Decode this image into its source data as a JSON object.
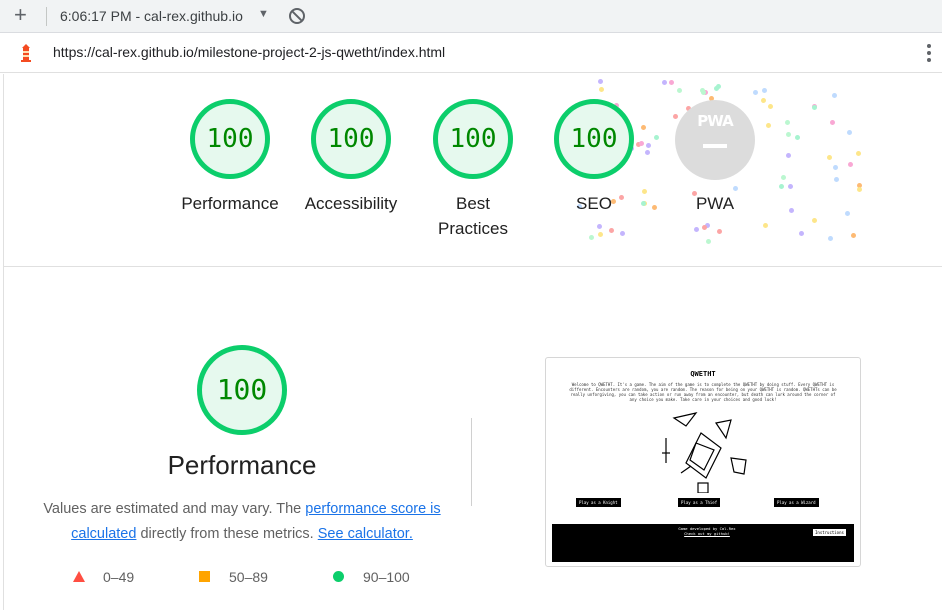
{
  "browser": {
    "tab_title": "6:06:17 PM - cal-rex.github.io",
    "url": "https://cal-rex.github.io/milestone-project-2-js-qwetht/index.html"
  },
  "summary_gauges": [
    {
      "label": "Performance",
      "score": "100"
    },
    {
      "label": "Accessibility",
      "score": "100"
    },
    {
      "label": "Best Practices",
      "score": "100"
    },
    {
      "label": "SEO",
      "score": "100"
    }
  ],
  "pwa": {
    "badge_text": "PWA",
    "label": "PWA"
  },
  "performance": {
    "score": "100",
    "title": "Performance",
    "desc_prefix": "Values are estimated and may vary. The ",
    "desc_link1": "performance score is calculated",
    "desc_mid": " directly from these metrics. ",
    "desc_link2": "See calculator."
  },
  "legend": [
    {
      "range": "0–49",
      "color": "#ff4e42"
    },
    {
      "range": "50–89",
      "color": "#ffa400"
    },
    {
      "range": "90–100",
      "color": "#0cce6b"
    }
  ],
  "screenshot": {
    "title": "QWETHT",
    "intro": "Welcome to QWETHT. It's a game. The aim of the game is to complete the QWETHT by doing stuff. Every QWETHT is different. Encounters are random, you are random. The reason for being on your QWETHT is random. QWETHTs can be really unforgiving, you can take action or run away from an encounter, but death can lurk around the corner of any choice you make. Take care in your choices and good luck!",
    "buttons": [
      "Play as a Knight",
      "Play as a Thief",
      "Play as a Wizard"
    ],
    "footer_line1": "Game developed by Cal-Rex",
    "footer_line2": "Check out my github!",
    "instructions": "Instructions"
  }
}
